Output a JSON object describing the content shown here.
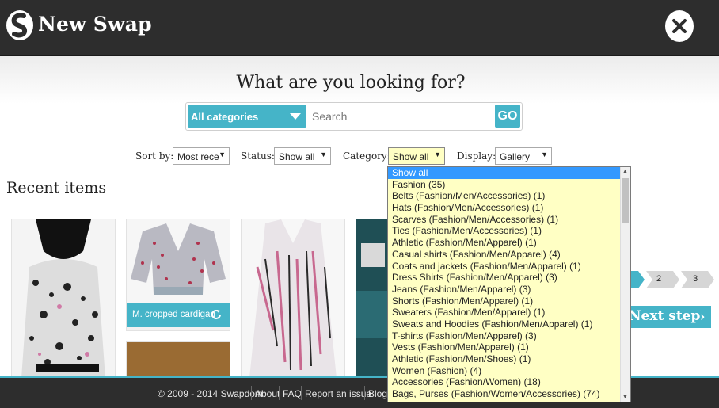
{
  "app": {
    "title": "New Swap"
  },
  "heading": "What are you looking for?",
  "search": {
    "category": "All categories",
    "placeholder": "Search",
    "go": "GO"
  },
  "filters": {
    "sort_label": "Sort by:",
    "sort_value": "Most recen",
    "status_label": "Status:",
    "status_value": "Show all",
    "category_label": "Category:",
    "category_value": "Show all",
    "display_label": "Display:",
    "display_value": "Gallery"
  },
  "recent_title": "Recent items",
  "items": [
    {
      "caption": "M. cropped cardigan"
    }
  ],
  "steps": {
    "step2": "2",
    "step3": "3",
    "next": "Next step",
    "next_arrow": "›"
  },
  "footer": {
    "copyright": "© 2009 - 2014 Swapdom",
    "links": [
      "About",
      "FAQ",
      "Report an issue",
      "Blog"
    ]
  },
  "category_options": [
    "Show all",
    "Fashion (35)",
    "Belts (Fashion/Men/Accessories) (1)",
    "Hats (Fashion/Men/Accessories) (1)",
    "Scarves (Fashion/Men/Accessories) (1)",
    "Ties (Fashion/Men/Accessories) (1)",
    "Athletic (Fashion/Men/Apparel) (1)",
    "Casual shirts (Fashion/Men/Apparel) (4)",
    "Coats and jackets (Fashion/Men/Apparel) (1)",
    "Dress Shirts (Fashion/Men/Apparel) (3)",
    "Jeans (Fashion/Men/Apparel) (3)",
    "Shorts (Fashion/Men/Apparel) (1)",
    "Sweaters (Fashion/Men/Apparel) (1)",
    "Sweats and Hoodies (Fashion/Men/Apparel) (1)",
    "T-shirts (Fashion/Men/Apparel) (3)",
    "Vests (Fashion/Men/Apparel) (1)",
    "Athletic (Fashion/Men/Shoes) (1)",
    "Women (Fashion) (4)",
    "Accessories (Fashion/Women) (18)",
    "Bags, Purses (Fashion/Women/Accessories) (74)"
  ],
  "colors": {
    "accent": "#45b4c8",
    "header": "#2d2d2d",
    "dropdown_bg": "#ffffc4",
    "selected": "#3399ff"
  }
}
